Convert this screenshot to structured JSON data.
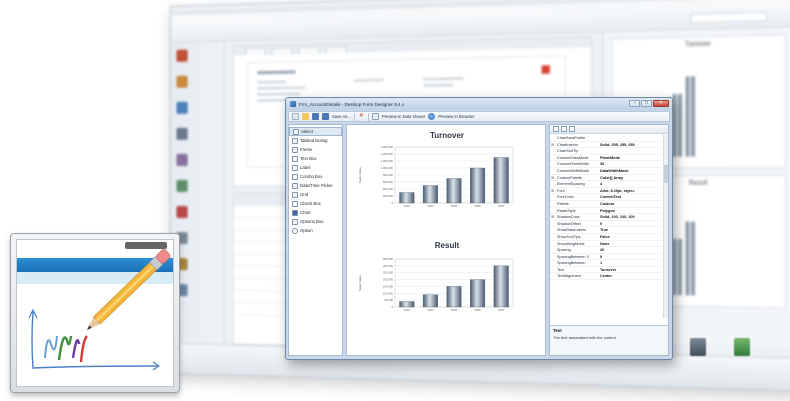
{
  "designer": {
    "title": "Frm_AccountDetails - Desktop Form Designer 9.4.x",
    "toolbar": {
      "save_label": "Save As...",
      "preview_data_viewer_label": "Preview In Data Viewer",
      "preview_browser_label": "Preview In Browser"
    },
    "toolbox": [
      "Select",
      "Tabbed Dialog",
      "Frame",
      "Text Box",
      "Label",
      "Combo Box",
      "Date/Time Picker",
      "Grid",
      "Check Box",
      "Chart",
      "Options Box",
      "Option"
    ],
    "properties": [
      {
        "name": "ChartAreaProfile",
        "value": "",
        "expandable": false
      },
      {
        "name": "ChartInterior",
        "value": "Solid, 255, 255, 255",
        "expandable": true
      },
      {
        "name": "ChartToolTip",
        "value": "",
        "expandable": false
      },
      {
        "name": "ColumnDrawMode",
        "value": "PlaneMode",
        "expandable": false
      },
      {
        "name": "ColumnFixedWidth",
        "value": "30",
        "expandable": false
      },
      {
        "name": "ColumnWidthMode",
        "value": "DataWidthMode",
        "expandable": false
      },
      {
        "name": "CustomPalette",
        "value": "Color[] Array",
        "expandable": true
      },
      {
        "name": "ElementSpacing",
        "value": "4",
        "expandable": false
      },
      {
        "name": "Font",
        "value": "Arial, 8.25pt, style=",
        "expandable": true
      },
      {
        "name": "ForeColor",
        "value": "ControlText",
        "expandable": false
      },
      {
        "name": "Palette",
        "value": "Custom",
        "expandable": false
      },
      {
        "name": "RadarStyle",
        "value": "Polygon",
        "expandable": false
      },
      {
        "name": "ShadowColor",
        "value": "Solid, 100, 100, 100",
        "expandable": true
      },
      {
        "name": "ShadowOffset",
        "value": "0",
        "expandable": false
      },
      {
        "name": "ShowDataLabels",
        "value": "True",
        "expandable": false
      },
      {
        "name": "ShowToolTips",
        "value": "False",
        "expandable": false
      },
      {
        "name": "SmoothingMode",
        "value": "None",
        "expandable": false
      },
      {
        "name": "Spacing",
        "value": "20",
        "expandable": false
      },
      {
        "name": "SpacingBetween X",
        "value": "0",
        "expandable": false
      },
      {
        "name": "SpacingBetween",
        "value": "1",
        "expandable": false
      },
      {
        "name": "Text",
        "value": "Turnover",
        "expandable": false
      },
      {
        "name": "TextAlignment",
        "value": "Center",
        "expandable": false
      }
    ],
    "description": {
      "title": "Text",
      "text": "The text associated with the control."
    }
  },
  "chart_data": [
    {
      "type": "bar",
      "title": "Turnover",
      "categories": [
        "2003",
        "2004",
        "2005",
        "2006",
        "2007"
      ],
      "values": [
        300000,
        500000,
        700000,
        1000000,
        1300000
      ],
      "y_ticks": [
        "1.600,000",
        "1.400,000",
        "1.200,000",
        "1.000,000",
        "800,000",
        "600,000",
        "400,000",
        "200,000",
        "0"
      ],
      "ylabel": "Sales Value",
      "ylim": [
        0,
        1600000
      ],
      "legend": "none",
      "grid": true
    },
    {
      "type": "bar",
      "title": "Result",
      "categories": [
        "2003",
        "2004",
        "2005",
        "2006",
        "2007"
      ],
      "values": [
        40000,
        90000,
        150000,
        200000,
        300000
      ],
      "y_ticks": [
        "350,000",
        "300,000",
        "250,000",
        "200,000",
        "150,000",
        "100,000",
        "50,000",
        "0"
      ],
      "ylabel": "Sales Value",
      "ylim": [
        0,
        350000
      ],
      "legend": "none",
      "grid": true
    }
  ],
  "background_window": {
    "right_panel_titles": [
      "Turnover",
      "Result"
    ]
  },
  "colors": {
    "accent_blue": "#1b6fb6",
    "bar_dark": "#4a5c72",
    "bar_light": "#d9e1ea",
    "close_red": "#c8432c",
    "pencil_yellow": "#f3b43c"
  }
}
